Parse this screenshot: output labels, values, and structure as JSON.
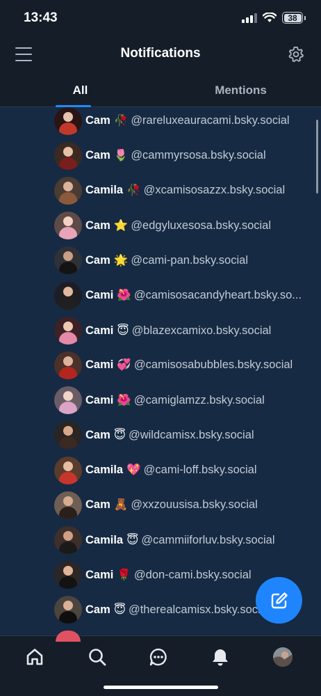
{
  "status_bar": {
    "time": "13:43",
    "battery": "38"
  },
  "header": {
    "title": "Notifications",
    "menu_icon": "hamburger-menu-icon",
    "settings_icon": "gear-icon"
  },
  "tabs": {
    "all": "All",
    "mentions": "Mentions",
    "active": "All",
    "accent_color": "#1e8bff"
  },
  "notifications": [
    {
      "name": "Cam",
      "emoji": "🥀",
      "handle": "@rareluxeauracami.bsky.social"
    },
    {
      "name": "Cam",
      "emoji": "🌷",
      "handle": "@cammyrsosa.bsky.social"
    },
    {
      "name": "Camila",
      "emoji": "🥀",
      "handle": "@xcamisosazzx.bsky.social"
    },
    {
      "name": "Cam",
      "emoji": "⭐",
      "handle": "@edgyluxesosa.bsky.social"
    },
    {
      "name": "Cam",
      "emoji": "🌟",
      "handle": "@cami-pan.bsky.social"
    },
    {
      "name": "Cami",
      "emoji": "🌺",
      "handle": "@camisosacandyheart.bsky.so..."
    },
    {
      "name": "Cami",
      "emoji": "😇",
      "handle": "@blazexcamixo.bsky.social"
    },
    {
      "name": "Cami",
      "emoji": "💞",
      "handle": "@camisosabubbles.bsky.social"
    },
    {
      "name": "Cami",
      "emoji": "🌺",
      "handle": "@camiglamzz.bsky.social"
    },
    {
      "name": "Cam",
      "emoji": "😇",
      "handle": "@wildcamisx.bsky.social"
    },
    {
      "name": "Camila",
      "emoji": "💖",
      "handle": "@cami-loff.bsky.social"
    },
    {
      "name": "Cam",
      "emoji": "🧸",
      "handle": "@xxzouusisa.bsky.social"
    },
    {
      "name": "Camila",
      "emoji": "😇",
      "handle": "@cammiiforluv.bsky.social"
    },
    {
      "name": "Cami",
      "emoji": "🌹",
      "handle": "@don-cami.bsky.social"
    },
    {
      "name": "Cam",
      "emoji": "😇",
      "handle": "@therealcamisx.bsky.social"
    }
  ],
  "fab": {
    "icon": "compose-icon",
    "color": "#1e85ff"
  },
  "bottom_nav": {
    "items": [
      "home-icon",
      "search-icon",
      "chat-icon",
      "bell-icon",
      "profile-avatar"
    ]
  }
}
